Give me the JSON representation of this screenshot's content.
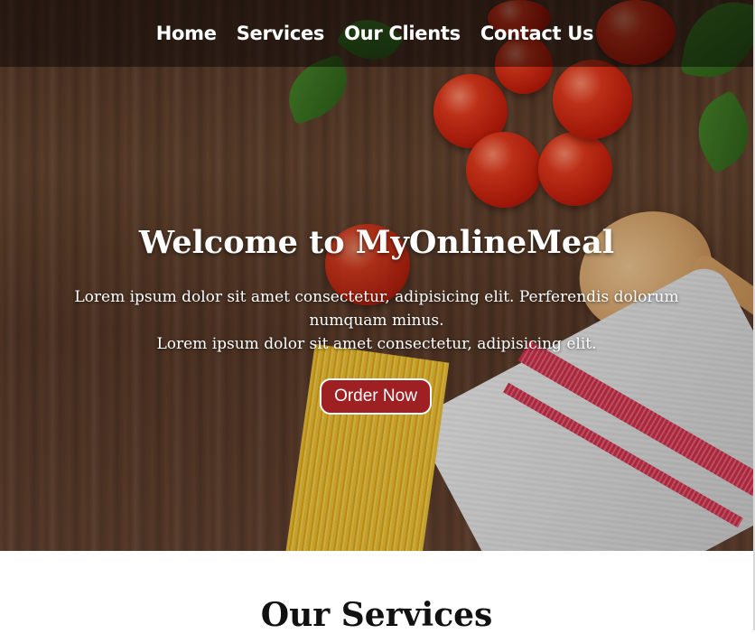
{
  "nav": {
    "links": [
      {
        "label": "Home"
      },
      {
        "label": "Services"
      },
      {
        "label": "Our Clients"
      },
      {
        "label": "Contact Us"
      }
    ]
  },
  "hero": {
    "title": "Welcome to MyOnlineMeal",
    "text_line1": "Lorem ipsum dolor sit amet consectetur, adipisicing elit. Perferendis dolorum numquam minus.",
    "text_line2": "Lorem ipsum dolor sit amet consectetur, adipisicing elit.",
    "button_label": "Order Now",
    "button_color": "#9e2023",
    "background_image": "wooden table with tomatoes, basil, wooden spoon, spaghetti and kitchen towel"
  },
  "services": {
    "heading": "Our Services"
  }
}
